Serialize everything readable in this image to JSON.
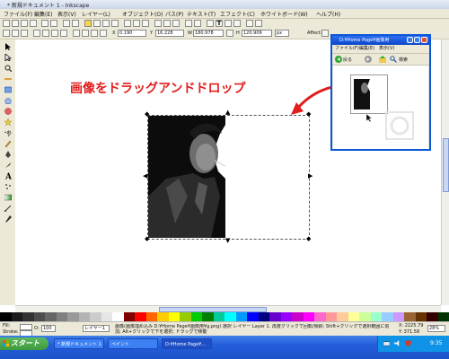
{
  "window": {
    "title": "* 新規ドキュメント 1 - Inkscape"
  },
  "menu": {
    "items": [
      "ファイル(F)",
      "編集(E)",
      "表示(V)",
      "レイヤー(L)",
      "オブジェクト(O)",
      "パス(P)",
      "テキスト(T)",
      "エフェクト(C)",
      "ホワイトボード(W)",
      "ヘルプ(H)"
    ]
  },
  "toolbar": {
    "x_label": "X",
    "x_value": "0.190",
    "y_label": "Y",
    "y_value": "16.228",
    "w_label": "W",
    "w_value": "180.978",
    "h_label": "H",
    "h_value": "120.909",
    "unit": "px",
    "affect_label": "Affect:"
  },
  "canvas": {
    "instruction": "画像をドラッグアンドドロップ"
  },
  "explorer": {
    "title": "D:¥Home Page¥画像用",
    "menu": [
      "ファイル(F)",
      "編集(E)",
      "表示(V)"
    ],
    "back_label": "戻る",
    "search_label": "検索"
  },
  "status": {
    "fill_label": "Fill:",
    "stroke_label": "Stroke:",
    "opacity": "O:",
    "opacity_value": "100",
    "layer": "レイヤー1",
    "message": "画像(画像埋め込み D:¥Home Page¥画像用¥g.png) 選択 レイヤー Layer 1. 再度クリックで回転/傾斜; Shift+クリックで選択範囲に追加; Alt+クリックで下を選択; ドラッグで移動",
    "x_coord": "X: 2225.79",
    "y_coord": "Y: 371.58",
    "zoom": "28%"
  },
  "taskbar": {
    "start_label": "スタート",
    "tasks": [
      "* 新規ドキュメント 1",
      "ペイント",
      "D:¥Home Page¥..."
    ],
    "clock": "9:35"
  },
  "colors": {
    "accent": "#e21d1d",
    "taskbar": "#245edb",
    "dialog_title": "#0b47c9",
    "chrome": "#ece9d8"
  }
}
